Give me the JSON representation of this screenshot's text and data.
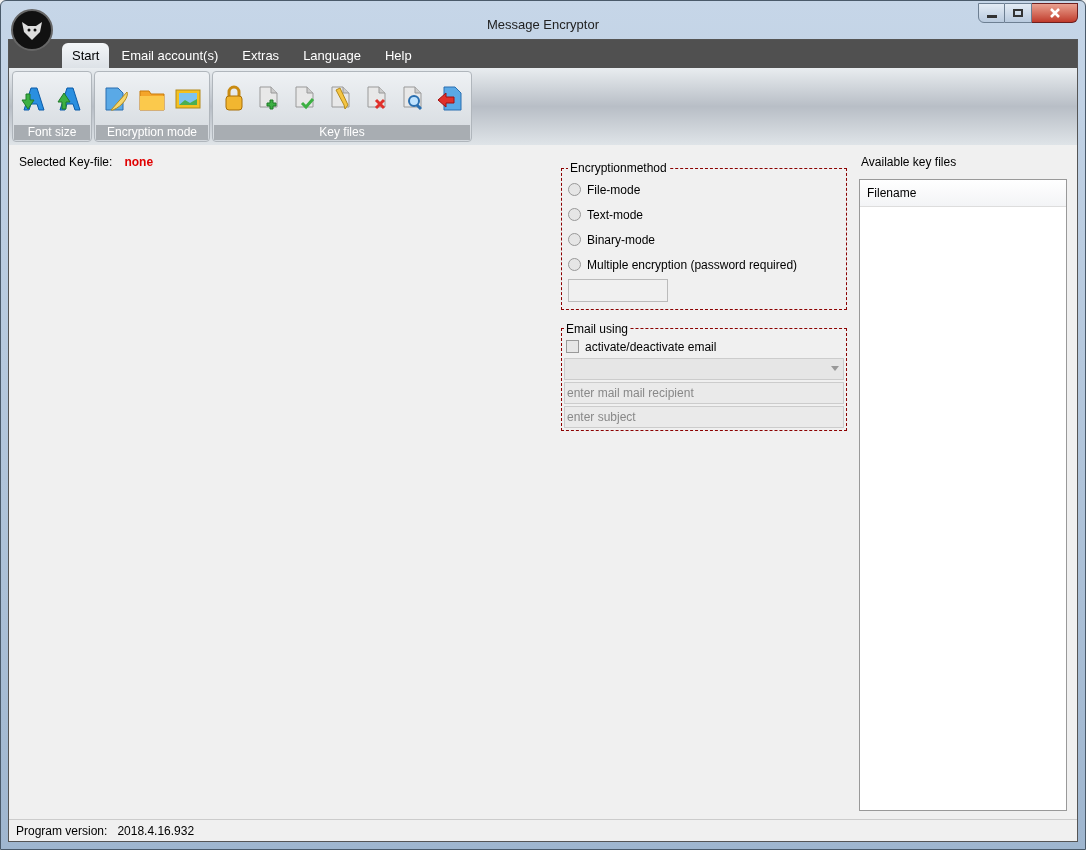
{
  "window": {
    "title": "Message Encryptor"
  },
  "tabs": [
    {
      "label": "Start",
      "selected": true
    },
    {
      "label": "Email account(s)",
      "selected": false
    },
    {
      "label": "Extras",
      "selected": false
    },
    {
      "label": "Language",
      "selected": false
    },
    {
      "label": "Help",
      "selected": false
    }
  ],
  "ribbon_groups": [
    {
      "label": "Font size"
    },
    {
      "label": "Encryption mode"
    },
    {
      "label": "Key files"
    }
  ],
  "selected_key_file": {
    "label": "Selected Key-file:",
    "value": "none"
  },
  "encryption_method": {
    "title": "Encryptionmethod",
    "options": [
      {
        "label": "File-mode",
        "selected": false
      },
      {
        "label": "Text-mode",
        "selected": false
      },
      {
        "label": "Binary-mode",
        "selected": false
      },
      {
        "label": "Multiple encryption (password required)",
        "selected": false
      }
    ]
  },
  "email": {
    "title": "Email using",
    "activate": {
      "label": "activate/deactivate email",
      "checked": false
    },
    "recipient": {
      "placeholder": "enter mail mail recipient"
    },
    "subject": {
      "placeholder": "enter subject"
    }
  },
  "key_files": {
    "title": "Available key files",
    "columns": [
      "Filename"
    ]
  },
  "status_bar": {
    "label": "Program version:",
    "value": "2018.4.16.932"
  }
}
